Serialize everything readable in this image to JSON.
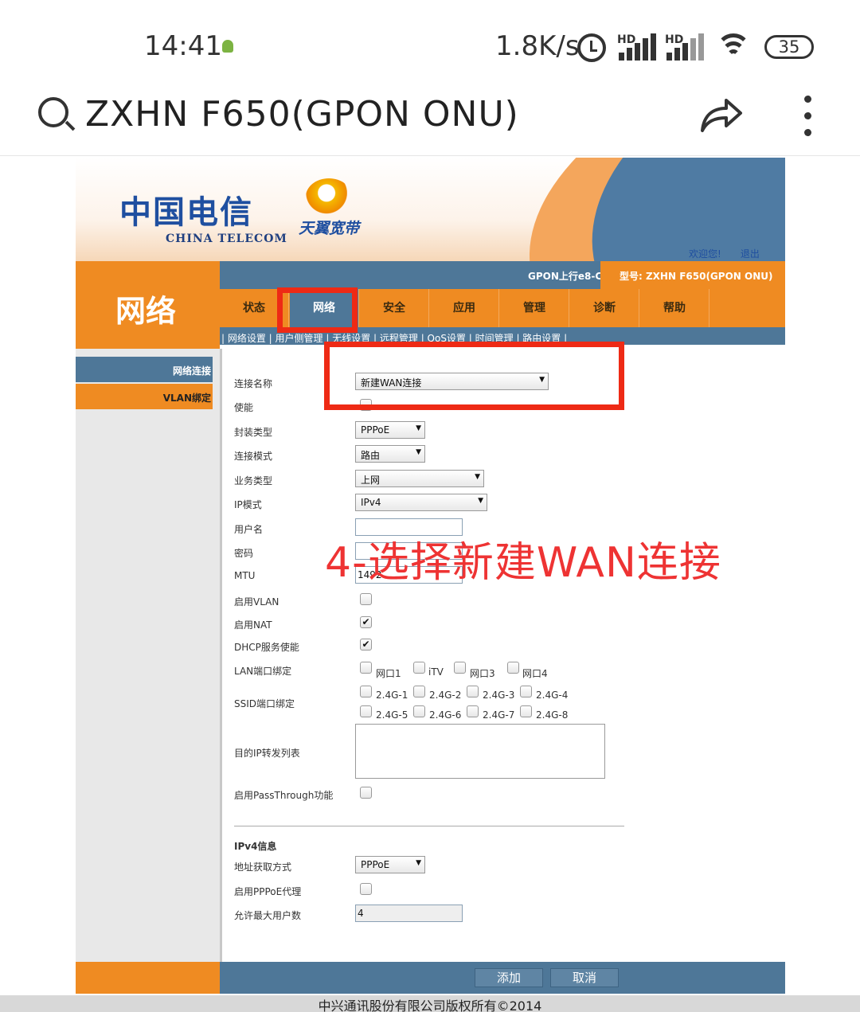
{
  "status_bar": {
    "time": "14:41",
    "net_speed": "1.8K/s",
    "signal1_label": "HD",
    "signal2_label": "HD",
    "battery": "35"
  },
  "address_bar": {
    "title": "ZXHN F650(GPON ONU)"
  },
  "router": {
    "logo_ct_cn": "中国电信",
    "logo_ct_en": "CHINA TELECOM",
    "logo_ty": "天翼宽带",
    "welcome": "欢迎您!",
    "logout": "退出",
    "section_title": "网络",
    "gpon_label": "GPON上行e8-C",
    "model": "型号:  ZXHN F650(GPON ONU)",
    "tabs": [
      {
        "label": "状态"
      },
      {
        "label": "网络"
      },
      {
        "label": "安全"
      },
      {
        "label": "应用"
      },
      {
        "label": "管理"
      },
      {
        "label": "诊断"
      },
      {
        "label": "帮助"
      }
    ],
    "subnav": "| 网络设置 | 用户侧管理 | 无线设置 | 远程管理 | QoS设置 | 时间管理 | 路由设置 |",
    "left_menu": [
      "网络连接",
      "VLAN绑定"
    ],
    "form": {
      "conn_name_label": "连接名称",
      "conn_name_value": "新建WAN连接",
      "enable_label": "使能",
      "encap_label": "封装类型",
      "encap_value": "PPPoE",
      "mode_label": "连接模式",
      "mode_value": "路由",
      "service_label": "业务类型",
      "service_value": "上网",
      "ipmode_label": "IP模式",
      "ipmode_value": "IPv4",
      "username_label": "用户名",
      "username_value": "",
      "password_label": "密码",
      "mtu_label": "MTU",
      "mtu_value": "1492",
      "vlan_label": "启用VLAN",
      "vlan_checked": false,
      "nat_label": "启用NAT",
      "nat_checked": true,
      "dhcp_label": "DHCP服务使能",
      "dhcp_checked": true,
      "lan_bind_label": "LAN端口绑定",
      "lan_ports": [
        "网口1",
        "iTV",
        "网口3",
        "网口4"
      ],
      "ssid_bind_label": "SSID端口绑定",
      "ssids_row1": [
        "2.4G-1",
        "2.4G-2",
        "2.4G-3",
        "2.4G-4"
      ],
      "ssids_row2": [
        "2.4G-5",
        "2.4G-6",
        "2.4G-7",
        "2.4G-8"
      ],
      "dest_ip_label": "目的IP转发列表",
      "passthrough_label": "启用PassThrough功能",
      "ipv4_header": "IPv4信息",
      "addr_method_label": "地址获取方式",
      "addr_method_value": "PPPoE",
      "pppoe_proxy_label": "启用PPPoE代理",
      "max_users_label": "允许最大用户数",
      "max_users_value": "4"
    },
    "add_button": "添加",
    "cancel_button": "取消",
    "footer": "中兴通讯股份有限公司版权所有©2014"
  },
  "annotation": "4-选择新建WAN连接",
  "colors": {
    "orange": "#ef8b22",
    "blue": "#4e7798",
    "annotation_red": "#ee2a15"
  }
}
